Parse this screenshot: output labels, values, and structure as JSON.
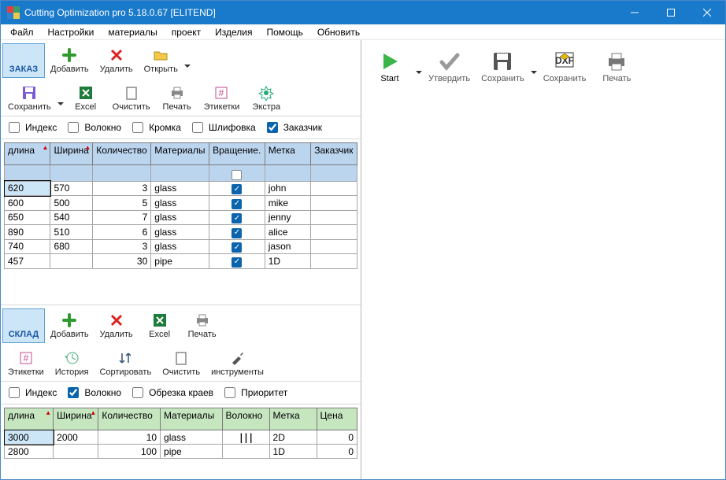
{
  "window": {
    "title": "Cutting Optimization pro 5.18.0.67 [ELITEND]"
  },
  "menu": [
    "Файл",
    "Настройки",
    "материалы",
    "проект",
    "Изделия",
    "Помощь",
    "Обновить"
  ],
  "order": {
    "tab": "ЗАКАЗ",
    "toolbar1": {
      "add": "Добавить",
      "delete": "Удалить",
      "open": "Открыть"
    },
    "toolbar2": {
      "save": "Сохранить",
      "excel": "Excel",
      "clear": "Очистить",
      "print": "Печать",
      "labels": "Этикетки",
      "extra": "Экстра"
    },
    "filters": {
      "index": "Индекс",
      "fiber": "Волокно",
      "edge": "Кромка",
      "polish": "Шлифовка",
      "customer": "Заказчик",
      "checked": {
        "index": false,
        "fiber": false,
        "edge": false,
        "polish": false,
        "customer": true
      }
    },
    "columns": [
      "длина",
      "Ширина",
      "Количество",
      "Материалы",
      "Вращение.",
      "Метка",
      "Заказчик"
    ],
    "rows": [
      {
        "length": "620",
        "width": "570",
        "qty": "3",
        "mat": "glass",
        "rot": true,
        "label": "john",
        "cust": ""
      },
      {
        "length": "600",
        "width": "500",
        "qty": "5",
        "mat": "glass",
        "rot": true,
        "label": "mike",
        "cust": ""
      },
      {
        "length": "650",
        "width": "540",
        "qty": "7",
        "mat": "glass",
        "rot": true,
        "label": "jenny",
        "cust": ""
      },
      {
        "length": "890",
        "width": "510",
        "qty": "6",
        "mat": "glass",
        "rot": true,
        "label": "alice",
        "cust": ""
      },
      {
        "length": "740",
        "width": "680",
        "qty": "3",
        "mat": "glass",
        "rot": true,
        "label": "jason",
        "cust": ""
      },
      {
        "length": "457",
        "width": "",
        "qty": "30",
        "mat": "pipe",
        "rot": true,
        "label": "1D",
        "cust": ""
      }
    ]
  },
  "stock": {
    "tab": "СКЛАД",
    "toolbar1": {
      "add": "Добавить",
      "delete": "Удалить",
      "excel": "Excel",
      "print": "Печать"
    },
    "toolbar2": {
      "labels": "Этикетки",
      "history": "История",
      "sort": "Сортировать",
      "clear": "Очистить",
      "tools": "инструменты"
    },
    "filters": {
      "index": "Индекс",
      "fiber": "Волокно",
      "trim": "Обрезка краев",
      "priority": "Приоритет",
      "checked": {
        "index": false,
        "fiber": true,
        "trim": false,
        "priority": false
      }
    },
    "columns": [
      "длина",
      "Ширина",
      "Количество",
      "Материалы",
      "Волокно",
      "Метка",
      "Цена"
    ],
    "rows": [
      {
        "length": "3000",
        "width": "2000",
        "qty": "10",
        "mat": "glass",
        "fiber": "|||",
        "label": "2D",
        "price": "0"
      },
      {
        "length": "2800",
        "width": "",
        "qty": "100",
        "mat": "pipe",
        "fiber": "",
        "label": "1D",
        "price": "0"
      }
    ]
  },
  "right_toolbar": {
    "start": "Start",
    "approve": "Утвердить",
    "save": "Сохранить",
    "dxf": "Сохранить",
    "print": "Печать"
  }
}
